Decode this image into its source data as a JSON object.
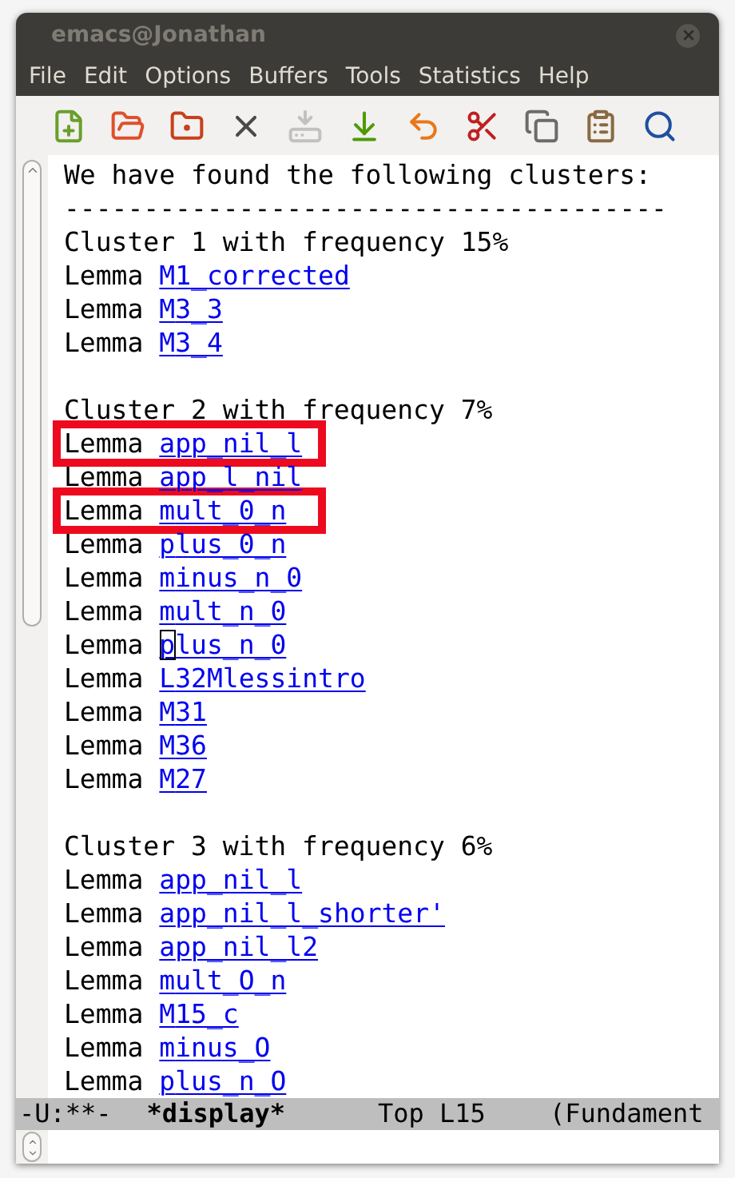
{
  "window": {
    "title": "emacs@Jonathan"
  },
  "menu": [
    "File",
    "Edit",
    "Options",
    "Buffers",
    "Tools",
    "Statistics",
    "Help"
  ],
  "toolbar": [
    {
      "kind": "new",
      "disabled": false
    },
    {
      "kind": "open",
      "disabled": false
    },
    {
      "kind": "home",
      "disabled": false
    },
    {
      "kind": "close",
      "disabled": false
    },
    {
      "kind": "save",
      "disabled": true
    },
    {
      "kind": "saveas",
      "disabled": false
    },
    {
      "kind": "undo",
      "disabled": false
    },
    {
      "kind": "cut",
      "disabled": false
    },
    {
      "kind": "copy",
      "disabled": false
    },
    {
      "kind": "paste",
      "disabled": false
    },
    {
      "kind": "search",
      "disabled": false
    }
  ],
  "buffer": [
    {
      "kind": "text",
      "text": "We have found the following clusters:"
    },
    {
      "kind": "text",
      "text": "--------------------------------------"
    },
    {
      "kind": "text",
      "text": "Cluster 1 with frequency 15%"
    },
    {
      "kind": "lemma",
      "keyword": "Lemma",
      "name": "M1_corrected",
      "highlighted": false,
      "cursor": false
    },
    {
      "kind": "lemma",
      "keyword": "Lemma",
      "name": "M3_3",
      "highlighted": false,
      "cursor": false
    },
    {
      "kind": "lemma",
      "keyword": "Lemma",
      "name": "M3_4",
      "highlighted": false,
      "cursor": false
    },
    {
      "kind": "blank"
    },
    {
      "kind": "text",
      "text": "Cluster 2 with frequency 7%"
    },
    {
      "kind": "lemma",
      "keyword": "Lemma",
      "name": "app_nil_l",
      "highlighted": true,
      "cursor": false
    },
    {
      "kind": "lemma",
      "keyword": "Lemma",
      "name": "app_l_nil",
      "highlighted": false,
      "cursor": false
    },
    {
      "kind": "lemma",
      "keyword": "Lemma",
      "name": "mult_0_n",
      "highlighted": true,
      "cursor": false
    },
    {
      "kind": "lemma",
      "keyword": "Lemma",
      "name": "plus_0_n",
      "highlighted": false,
      "cursor": false
    },
    {
      "kind": "lemma",
      "keyword": "Lemma",
      "name": "minus_n_0",
      "highlighted": false,
      "cursor": false
    },
    {
      "kind": "lemma",
      "keyword": "Lemma",
      "name": "mult_n_0",
      "highlighted": false,
      "cursor": false
    },
    {
      "kind": "lemma",
      "keyword": "Lemma",
      "name": "plus_n_0",
      "highlighted": false,
      "cursor": true
    },
    {
      "kind": "lemma",
      "keyword": "Lemma",
      "name": "L32Mlessintro",
      "highlighted": false,
      "cursor": false
    },
    {
      "kind": "lemma",
      "keyword": "Lemma",
      "name": "M31",
      "highlighted": false,
      "cursor": false
    },
    {
      "kind": "lemma",
      "keyword": "Lemma",
      "name": "M36",
      "highlighted": false,
      "cursor": false
    },
    {
      "kind": "lemma",
      "keyword": "Lemma",
      "name": "M27",
      "highlighted": false,
      "cursor": false
    },
    {
      "kind": "blank"
    },
    {
      "kind": "text",
      "text": "Cluster 3 with frequency 6%"
    },
    {
      "kind": "lemma",
      "keyword": "Lemma",
      "name": "app_nil_l",
      "highlighted": false,
      "cursor": false
    },
    {
      "kind": "lemma",
      "keyword": "Lemma",
      "name": "app_nil_l_shorter'",
      "highlighted": false,
      "cursor": false
    },
    {
      "kind": "lemma",
      "keyword": "Lemma",
      "name": "app_nil_l2",
      "highlighted": false,
      "cursor": false
    },
    {
      "kind": "lemma",
      "keyword": "Lemma",
      "name": "mult_O_n",
      "highlighted": false,
      "cursor": false
    },
    {
      "kind": "lemma",
      "keyword": "Lemma",
      "name": "M15_c",
      "highlighted": false,
      "cursor": false
    },
    {
      "kind": "lemma",
      "keyword": "Lemma",
      "name": "minus_O",
      "highlighted": false,
      "cursor": false
    },
    {
      "kind": "lemma",
      "keyword": "Lemma",
      "name": "plus_n_O",
      "highlighted": false,
      "cursor": false
    }
  ],
  "mode_line": {
    "status": "-U:**-",
    "buffer_name": "*display*",
    "position": "Top L15",
    "mode": "(Fundament"
  }
}
